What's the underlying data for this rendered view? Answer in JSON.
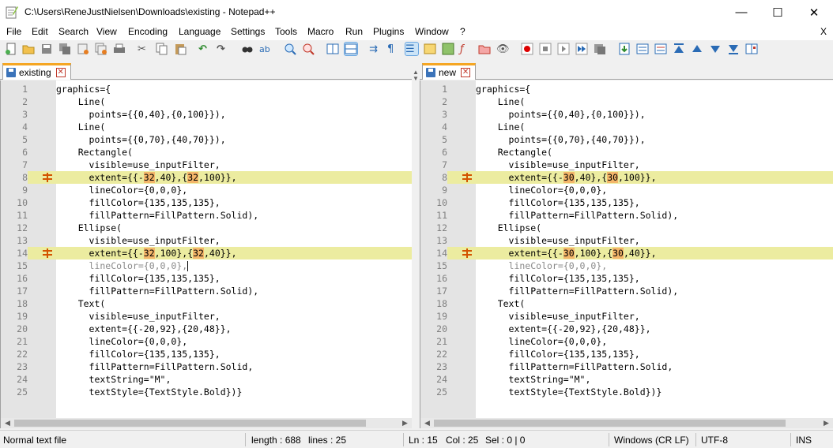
{
  "window": {
    "title": "C:\\Users\\ReneJustNielsen\\Downloads\\existing - Notepad++",
    "minimize": "—",
    "maximize": "☐",
    "close": "✕"
  },
  "menu": {
    "items": [
      "File",
      "Edit",
      "Search",
      "View",
      "Encoding",
      "Language",
      "Settings",
      "Tools",
      "Macro",
      "Run",
      "Plugins",
      "Window",
      "?"
    ],
    "close": "X"
  },
  "toolbar": {
    "icons": [
      "new-file-icon",
      "open-file-icon",
      "save-icon",
      "save-all-icon",
      "close-icon",
      "close-all-icon",
      "print-icon",
      "cut-icon",
      "copy-icon",
      "paste-icon",
      "undo-icon",
      "redo-icon",
      "find-icon",
      "replace-icon",
      "zoom-in-icon",
      "zoom-out-icon",
      "sync-vertical-icon",
      "sync-horizontal-icon",
      "word-wrap-icon",
      "show-all-chars-icon",
      "indent-guide-icon",
      "udl-icon",
      "doc-map-icon",
      "function-list-icon",
      "folder-workspace-icon",
      "monitoring-icon",
      "record-macro-icon",
      "stop-macro-icon",
      "play-macro-icon",
      "run-macro-multiple-icon",
      "save-macro-icon",
      "compare-icon",
      "compare-clear-icon",
      "diff-first-icon",
      "diff-prev-icon",
      "diff-next-icon",
      "diff-last-icon",
      "nav-bar-icon"
    ]
  },
  "tabs": {
    "left": {
      "label": "existing",
      "close": "✕"
    },
    "right": {
      "label": "new",
      "close": "✕"
    }
  },
  "left_lines": [
    {
      "n": "1",
      "segs": [
        "graphics={"
      ]
    },
    {
      "n": "2",
      "segs": [
        "    Line("
      ]
    },
    {
      "n": "3",
      "segs": [
        "      points={{0,40},{0,100}}),"
      ]
    },
    {
      "n": "4",
      "segs": [
        "    Line("
      ]
    },
    {
      "n": "5",
      "segs": [
        "      points={{0,70},{40,70}}),"
      ]
    },
    {
      "n": "6",
      "segs": [
        "    Rectangle("
      ]
    },
    {
      "n": "7",
      "segs": [
        "      visible=use_inputFilter,"
      ]
    },
    {
      "n": "8",
      "changed": true,
      "segs": [
        "      extent={{-",
        "32",
        ",40},{",
        "32",
        ",100}},"
      ]
    },
    {
      "n": "9",
      "segs": [
        "      lineColor={0,0,0},"
      ]
    },
    {
      "n": "10",
      "segs": [
        "      fillColor={135,135,135},"
      ]
    },
    {
      "n": "11",
      "segs": [
        "      fillPattern=FillPattern.Solid),"
      ]
    },
    {
      "n": "12",
      "segs": [
        "    Ellipse("
      ]
    },
    {
      "n": "13",
      "segs": [
        "      visible=use_inputFilter,"
      ]
    },
    {
      "n": "14",
      "changed": true,
      "segs": [
        "      extent={{-",
        "32",
        ",100},{",
        "32",
        ",40}},"
      ]
    },
    {
      "n": "15",
      "faded": true,
      "caret": true,
      "segs": [
        "      lineColor={0,0,0},"
      ]
    },
    {
      "n": "16",
      "segs": [
        "      fillColor={135,135,135},"
      ]
    },
    {
      "n": "17",
      "segs": [
        "      fillPattern=FillPattern.Solid),"
      ]
    },
    {
      "n": "18",
      "segs": [
        "    Text("
      ]
    },
    {
      "n": "19",
      "segs": [
        "      visible=use_inputFilter,"
      ]
    },
    {
      "n": "20",
      "segs": [
        "      extent={{-20,92},{20,48}},"
      ]
    },
    {
      "n": "21",
      "segs": [
        "      lineColor={0,0,0},"
      ]
    },
    {
      "n": "22",
      "segs": [
        "      fillColor={135,135,135},"
      ]
    },
    {
      "n": "23",
      "segs": [
        "      fillPattern=FillPattern.Solid,"
      ]
    },
    {
      "n": "24",
      "segs": [
        "      textString=\"M\","
      ]
    },
    {
      "n": "25",
      "segs": [
        "      textStyle={TextStyle.Bold})}"
      ]
    }
  ],
  "right_lines": [
    {
      "n": "1",
      "segs": [
        "graphics={"
      ]
    },
    {
      "n": "2",
      "segs": [
        "    Line("
      ]
    },
    {
      "n": "3",
      "segs": [
        "      points={{0,40},{0,100}}),"
      ]
    },
    {
      "n": "4",
      "segs": [
        "    Line("
      ]
    },
    {
      "n": "5",
      "segs": [
        "      points={{0,70},{40,70}}),"
      ]
    },
    {
      "n": "6",
      "segs": [
        "    Rectangle("
      ]
    },
    {
      "n": "7",
      "segs": [
        "      visible=use_inputFilter,"
      ]
    },
    {
      "n": "8",
      "changed": true,
      "segs": [
        "      extent={{-",
        "30",
        ",40},{",
        "30",
        ",100}},"
      ]
    },
    {
      "n": "9",
      "segs": [
        "      lineColor={0,0,0},"
      ]
    },
    {
      "n": "10",
      "segs": [
        "      fillColor={135,135,135},"
      ]
    },
    {
      "n": "11",
      "segs": [
        "      fillPattern=FillPattern.Solid),"
      ]
    },
    {
      "n": "12",
      "segs": [
        "    Ellipse("
      ]
    },
    {
      "n": "13",
      "segs": [
        "      visible=use_inputFilter,"
      ]
    },
    {
      "n": "14",
      "changed": true,
      "segs": [
        "      extent={{-",
        "30",
        ",100},{",
        "30",
        ",40}},"
      ]
    },
    {
      "n": "15",
      "faded": true,
      "segs": [
        "      lineColor={0,0,0},"
      ]
    },
    {
      "n": "16",
      "segs": [
        "      fillColor={135,135,135},"
      ]
    },
    {
      "n": "17",
      "segs": [
        "      fillPattern=FillPattern.Solid),"
      ]
    },
    {
      "n": "18",
      "segs": [
        "    Text("
      ]
    },
    {
      "n": "19",
      "segs": [
        "      visible=use_inputFilter,"
      ]
    },
    {
      "n": "20",
      "segs": [
        "      extent={{-20,92},{20,48}},"
      ]
    },
    {
      "n": "21",
      "segs": [
        "      lineColor={0,0,0},"
      ]
    },
    {
      "n": "22",
      "segs": [
        "      fillColor={135,135,135},"
      ]
    },
    {
      "n": "23",
      "segs": [
        "      fillPattern=FillPattern.Solid,"
      ]
    },
    {
      "n": "24",
      "segs": [
        "      textString=\"M\","
      ]
    },
    {
      "n": "25",
      "segs": [
        "      textStyle={TextStyle.Bold})}"
      ]
    }
  ],
  "status": {
    "type": "Normal text file",
    "length": "length : 688",
    "lines": "lines : 25",
    "ln": "Ln : 15",
    "col": "Col : 25",
    "sel": "Sel : 0 | 0",
    "eol": "Windows (CR LF)",
    "encoding": "UTF-8",
    "mode": "INS"
  },
  "colors": {
    "changed_line": "#ececa0",
    "diff_highlight": "#f4b66a",
    "tab_accent": "#f5a623"
  }
}
